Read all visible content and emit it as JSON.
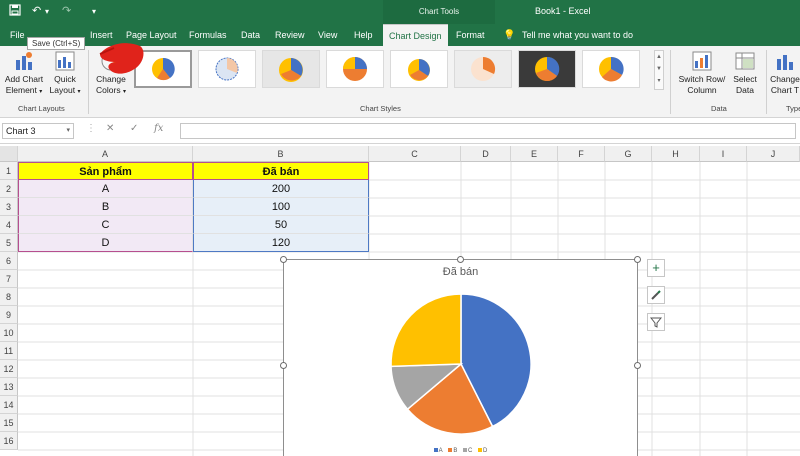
{
  "titlebar": {
    "context_tools": "Chart Tools",
    "app_title": "Book1 - Excel",
    "bg": "#217346"
  },
  "tabs": [
    "File",
    "Insert",
    "Page Layout",
    "Formulas",
    "Data",
    "Review",
    "View",
    "Help",
    "Chart Design",
    "Format"
  ],
  "active_tab": "Chart Design",
  "tell_me": "Tell me what you want to do",
  "tooltip": "Save (Ctrl+S)",
  "ribbon": {
    "add_chart_element_1": "Add Chart",
    "add_chart_element_2": "Element",
    "quick_layout_1": "Quick",
    "quick_layout_2": "Layout",
    "change_colors_1": "Change",
    "change_colors_2": "Colors",
    "group_chart_layouts": "Chart Layouts",
    "group_chart_styles": "Chart Styles",
    "switch_row_col_1": "Switch Row/",
    "switch_row_col_2": "Column",
    "select_data_1": "Select",
    "select_data_2": "Data",
    "group_data": "Data",
    "change_chart_type_1": "Change",
    "change_chart_type_2": "Chart T",
    "group_type": "Type"
  },
  "formula_bar": {
    "name_box": "Chart 3",
    "fx": "fx",
    "value": ""
  },
  "columns": [
    "A",
    "B",
    "C",
    "D",
    "E",
    "F",
    "G",
    "H",
    "I",
    "J"
  ],
  "rows": [
    "1",
    "2",
    "3",
    "4",
    "5",
    "6",
    "7",
    "8",
    "9",
    "10",
    "11",
    "12",
    "13",
    "14",
    "15",
    "16"
  ],
  "table": {
    "header_a": "Sản phẩm",
    "header_b": "Đã bán",
    "rows": [
      {
        "product": "A",
        "sold": "200"
      },
      {
        "product": "B",
        "sold": "100"
      },
      {
        "product": "C",
        "sold": "50"
      },
      {
        "product": "D",
        "sold": "120"
      }
    ]
  },
  "chart": {
    "title": "Đã bán",
    "legend": [
      "A",
      "B",
      "C",
      "D"
    ],
    "colors": [
      "#4472c4",
      "#ed7d31",
      "#a5a5a5",
      "#ffc000"
    ]
  },
  "chart_data": {
    "type": "pie",
    "title": "Đã bán",
    "categories": [
      "A",
      "B",
      "C",
      "D"
    ],
    "values": [
      200,
      100,
      50,
      120
    ],
    "legend_position": "bottom"
  }
}
